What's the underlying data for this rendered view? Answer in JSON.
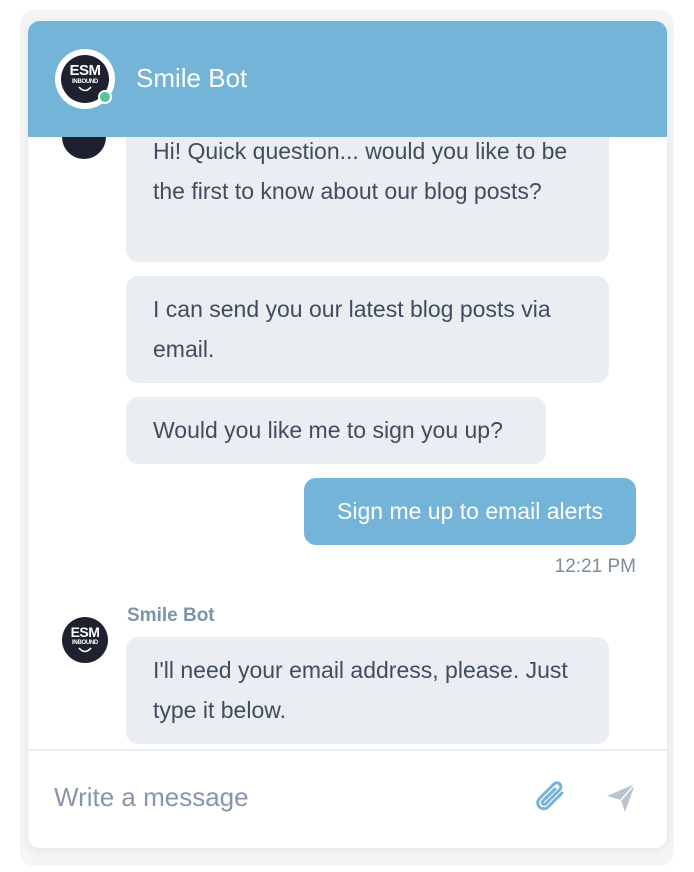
{
  "header": {
    "bot_name": "Smile Bot",
    "logo_line1": "ESM",
    "logo_line2": "INBOUND",
    "status_color": "#4fc69d",
    "accent_color": "#74b4d8"
  },
  "messages": [
    {
      "from": "bot",
      "text": "Hi! Quick question... would you like to be the first to know about our blog posts?"
    },
    {
      "from": "bot",
      "text": "I can send you our latest blog posts via email."
    },
    {
      "from": "bot",
      "text": "Would you like me to sign you up?"
    },
    {
      "from": "user",
      "text": "Sign me up to email alerts",
      "time": "12:21 PM"
    },
    {
      "from": "bot",
      "sender": "Smile Bot",
      "text": "I'll need your email address, please. Just type it below."
    }
  ],
  "composer": {
    "placeholder": "Write a message",
    "attach_icon": "paperclip-icon",
    "send_icon": "send-icon"
  }
}
